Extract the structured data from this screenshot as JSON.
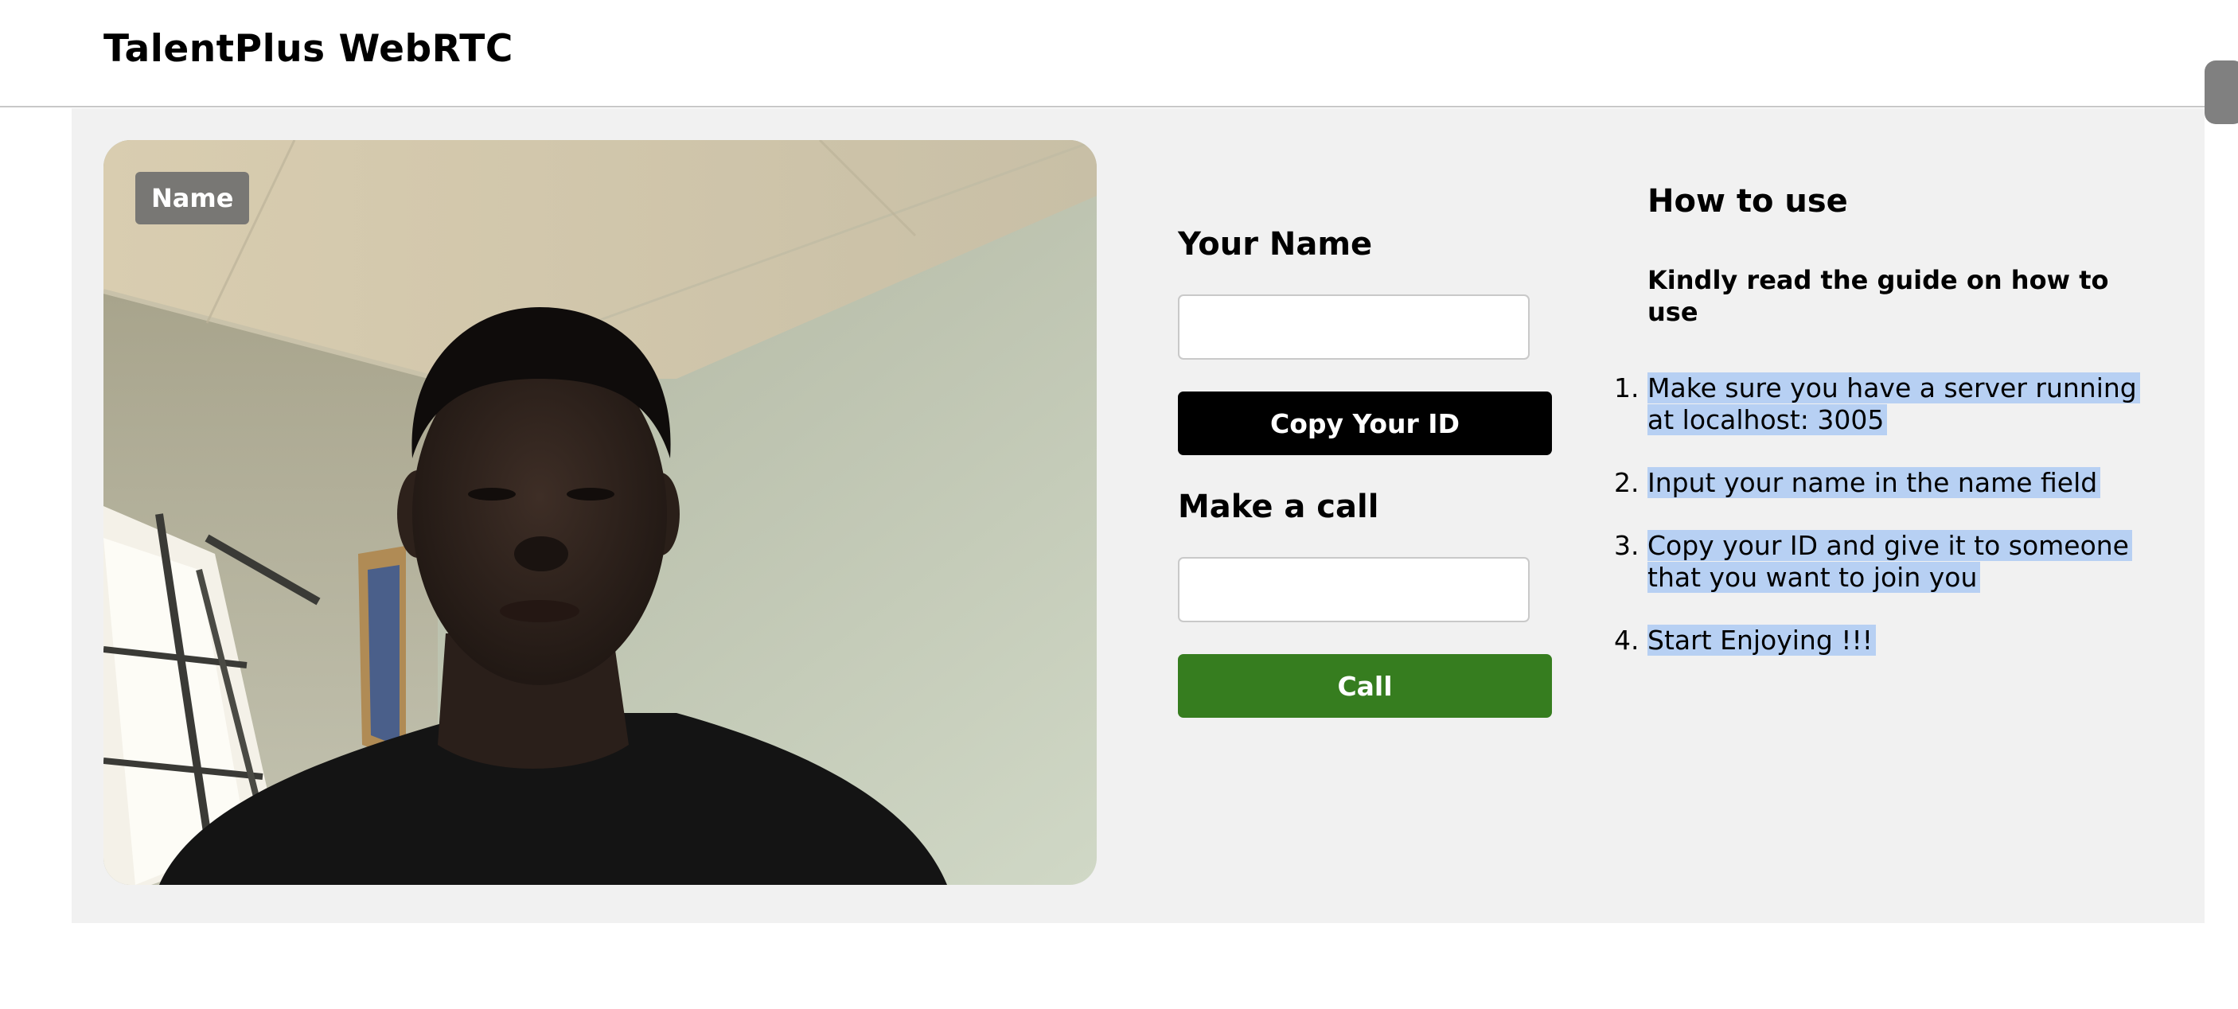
{
  "header": {
    "title": "TalentPlus WebRTC"
  },
  "video": {
    "name_label": "Name"
  },
  "form": {
    "your_name_heading": "Your Name",
    "name_input_value": "",
    "copy_id_label": "Copy Your ID",
    "make_call_heading": "Make a call",
    "call_input_value": "",
    "call_label": "Call"
  },
  "guide": {
    "title": "How to use",
    "subtitle": "Kindly read the guide on how to use",
    "steps": [
      {
        "num": "1.",
        "line1": "Make sure you have a server running",
        "line2": "at localhost: 3005"
      },
      {
        "num": "2.",
        "line1": "Input your name in the name field",
        "line2": ""
      },
      {
        "num": "3.",
        "line1": "Copy your ID and give it to someone",
        "line2": "that you want to join you"
      },
      {
        "num": "4.",
        "line1": "Start Enjoying !!!",
        "line2": ""
      }
    ]
  },
  "colors": {
    "copy_button": "#000000",
    "call_button": "#367d1f",
    "selection_highlight": "#b7d0f3",
    "panel_background": "#f1f1f1"
  }
}
